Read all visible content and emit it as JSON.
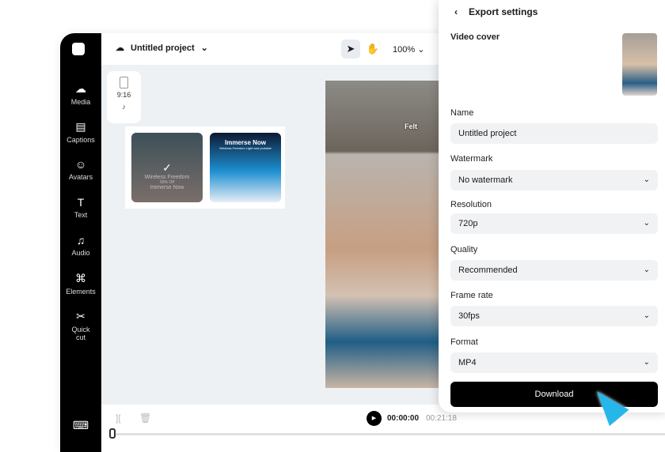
{
  "topbar": {
    "project": "Untitled project",
    "zoom": "100%"
  },
  "sidebar": [
    {
      "label": "Media",
      "icon": "☁"
    },
    {
      "label": "Captions",
      "icon": "▤"
    },
    {
      "label": "Avatars",
      "icon": "☺"
    },
    {
      "label": "Text",
      "icon": "T"
    },
    {
      "label": "Audio",
      "icon": "♫"
    },
    {
      "label": "Elements",
      "icon": "⌘"
    },
    {
      "label": "Quick cut",
      "icon": "✂"
    }
  ],
  "canvas": {
    "ratio": "9:16",
    "caption": "Felt",
    "templates": [
      {
        "title": "Wireless Freedom",
        "sub": "50% Off",
        "cta": "Immerse Now"
      },
      {
        "title": "Immerse Now",
        "sub": "Wireless Freedom Light and portable"
      }
    ]
  },
  "timeline": {
    "current": "00:00:00",
    "total": "00:21:18"
  },
  "export": {
    "title": "Export settings",
    "cover_label": "Video cover",
    "name_label": "Name",
    "name_value": "Untitled project",
    "watermark_label": "Watermark",
    "watermark": "No watermark",
    "resolution_label": "Resolution",
    "resolution": "720p",
    "quality_label": "Quality",
    "quality": "Recommended",
    "framerate_label": "Frame rate",
    "framerate": "30fps",
    "format_label": "Format",
    "format": "MP4",
    "download": "Download"
  }
}
